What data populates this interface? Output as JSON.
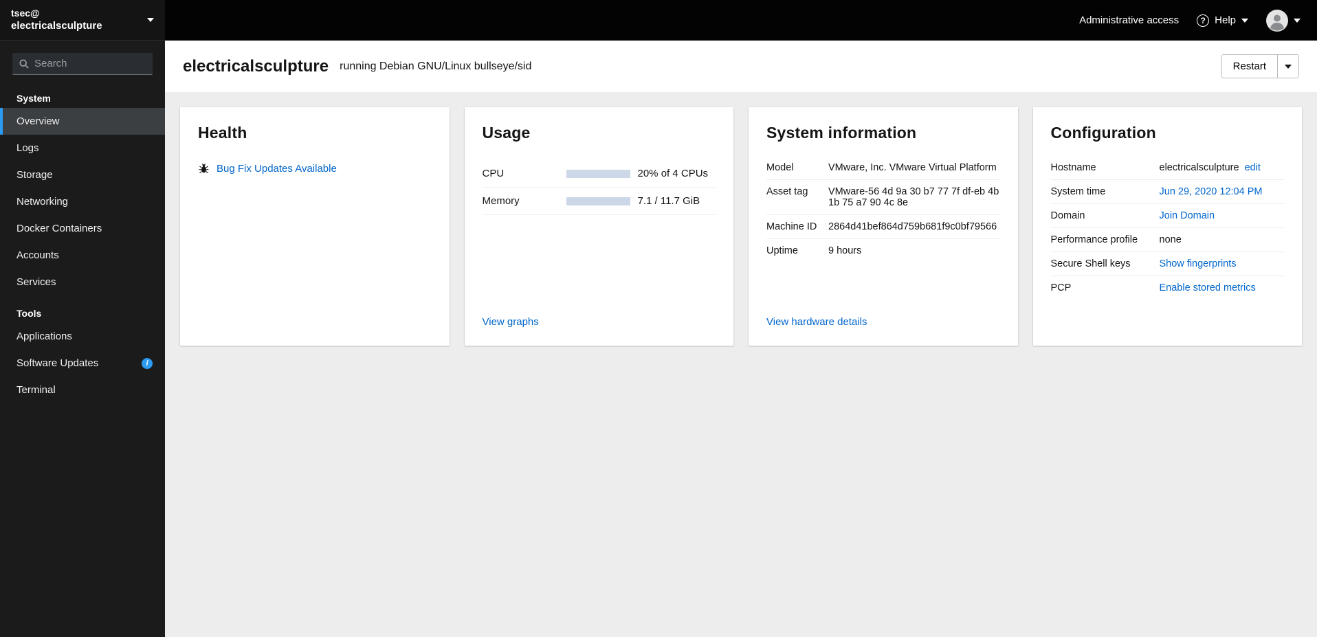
{
  "sidebar": {
    "user_line1": "tsec@",
    "user_line2": "electricalsculpture",
    "search_placeholder": "Search",
    "system_section_title": "System",
    "system_items": [
      "Overview",
      "Logs",
      "Storage",
      "Networking",
      "Docker Containers",
      "Accounts",
      "Services"
    ],
    "tools_section_title": "Tools",
    "tools_items": [
      "Applications",
      "Software Updates",
      "Terminal"
    ]
  },
  "masthead": {
    "admin_access_label": "Administrative access",
    "help_label": "Help"
  },
  "header": {
    "hostname": "electricalsculpture",
    "subtitle": "running Debian GNU/Linux bullseye/sid",
    "restart_label": "Restart"
  },
  "health": {
    "title": "Health",
    "updates_link": "Bug Fix Updates Available"
  },
  "usage": {
    "title": "Usage",
    "cpu_label": "CPU",
    "cpu_value": "20% of 4 CPUs",
    "cpu_percent": 22,
    "memory_label": "Memory",
    "memory_value": "7.1 / 11.7 GiB",
    "memory_percent": 61,
    "view_graphs_link": "View graphs"
  },
  "system_info": {
    "title": "System information",
    "rows": [
      {
        "label": "Model",
        "value": "VMware, Inc. VMware Virtual Platform"
      },
      {
        "label": "Asset tag",
        "value": "VMware-56 4d 9a 30 b7 77 7f df-eb 4b 1b 75 a7 90 4c 8e"
      },
      {
        "label": "Machine ID",
        "value": "2864d41bef864d759b681f9c0bf79566"
      },
      {
        "label": "Uptime",
        "value": "9 hours"
      }
    ],
    "hardware_link": "View hardware details"
  },
  "configuration": {
    "title": "Configuration",
    "hostname_label": "Hostname",
    "hostname_value": "electricalsculpture",
    "hostname_edit_link": "edit",
    "time_label": "System time",
    "time_value": "Jun 29, 2020 12:04 PM",
    "domain_label": "Domain",
    "domain_value": "Join Domain",
    "perf_label": "Performance profile",
    "perf_value": "none",
    "ssh_label": "Secure Shell keys",
    "ssh_value": "Show fingerprints",
    "pcp_label": "PCP",
    "pcp_value": "Enable stored metrics"
  },
  "icons": {
    "info_glyph": "i",
    "help_glyph": "?"
  },
  "colors": {
    "link": "#0066cc",
    "progress_fill": "#0066cc",
    "nav_selected_border": "#2b9af3"
  }
}
